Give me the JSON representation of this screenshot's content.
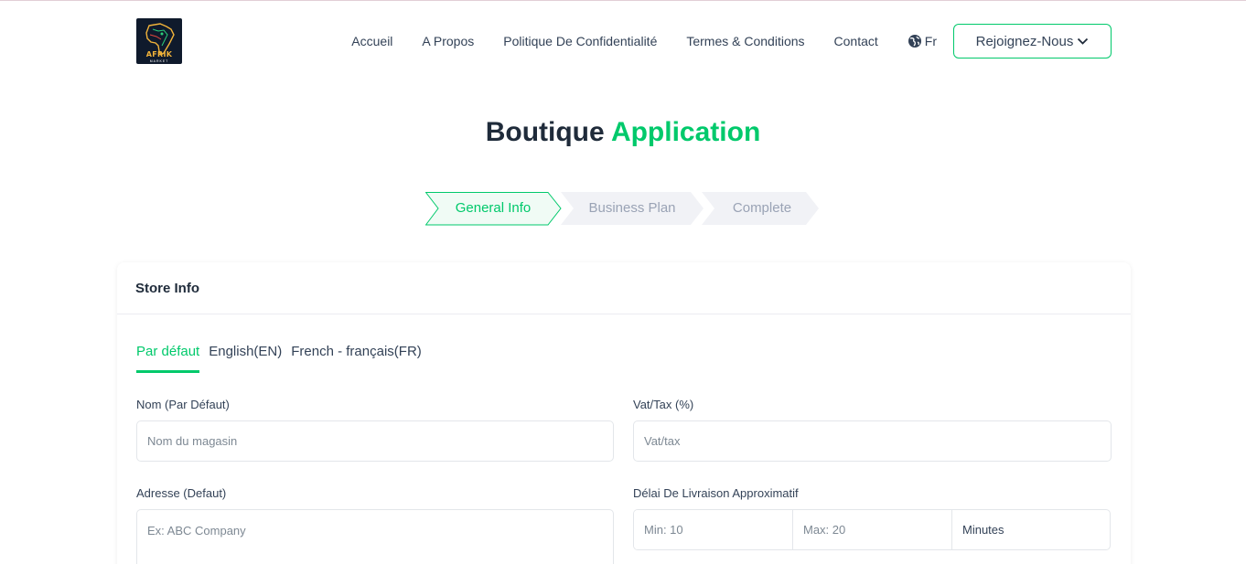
{
  "header": {
    "logo_text": "AFRIK",
    "logo_sub": "MARKET",
    "nav": [
      "Accueil",
      "A Propos",
      "Politique De Confidentialité",
      "Termes & Conditions",
      "Contact"
    ],
    "language": "Fr",
    "join_label": "Rejoignez-Nous"
  },
  "title": {
    "main": "Boutique",
    "accent": "Application"
  },
  "steps": [
    {
      "label": "General Info",
      "state": "active"
    },
    {
      "label": "Business Plan",
      "state": "inactive"
    },
    {
      "label": "Complete",
      "state": "inactive"
    }
  ],
  "card": {
    "title": "Store Info",
    "tabs": [
      "Par défaut",
      "English(EN)",
      "French - français(FR)"
    ],
    "name_label": "Nom (Par Défaut)",
    "name_placeholder": "Nom du magasin",
    "vat_label": "Vat/Tax (%)",
    "vat_placeholder": "Vat/tax",
    "address_label": "Adresse (Defaut)",
    "address_placeholder": "Ex: ABC Company",
    "delivery_label": "Délai De Livraison Approximatif",
    "delivery_min_placeholder": "Min: 10",
    "delivery_max_placeholder": "Max: 20",
    "delivery_unit": "Minutes"
  },
  "colors": {
    "accent": "#00c96b",
    "text": "#334257",
    "step_inactive_bg": "#f1f2f6",
    "step_active_bg": "#f0fbf5"
  }
}
